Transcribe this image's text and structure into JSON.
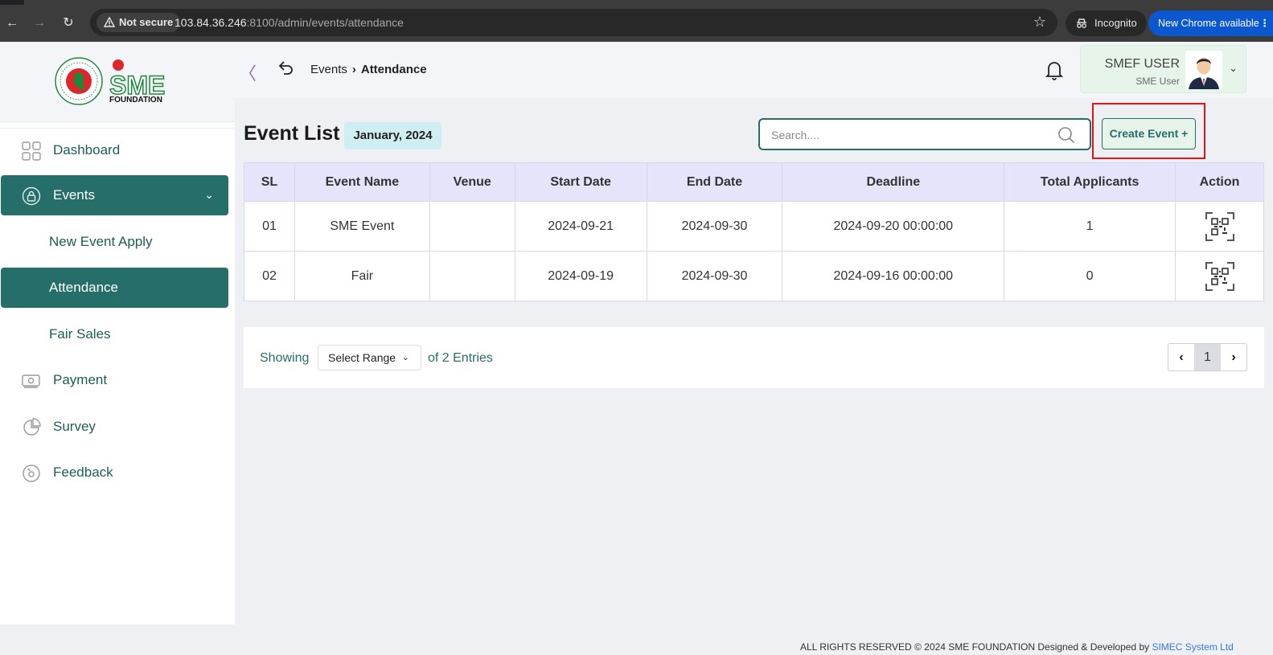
{
  "browser": {
    "security_label": "Not secure",
    "url_host": "103.84.36.246",
    "url_rest": ":8100/admin/events/attendance",
    "incognito_label": "Incognito",
    "update_label": "New Chrome available"
  },
  "logo": {
    "brand_text": "SME",
    "sub_text": "FOUNDATION"
  },
  "sidebar": {
    "items": [
      {
        "label": "Dashboard",
        "icon": "grid-icon"
      },
      {
        "label": "Events",
        "icon": "lock-circle-icon"
      },
      {
        "label": "New Event Apply"
      },
      {
        "label": "Attendance"
      },
      {
        "label": "Fair Sales"
      },
      {
        "label": "Payment",
        "icon": "money-icon"
      },
      {
        "label": "Survey",
        "icon": "pie-chart-icon"
      },
      {
        "label": "Feedback",
        "icon": "feedback-icon"
      }
    ],
    "caret": "⌄"
  },
  "topbar": {
    "collapse": "〈",
    "breadcrumb": {
      "parent": "Events",
      "current": "Attendance"
    },
    "user": {
      "name": "SMEF USER",
      "role": "SME User"
    }
  },
  "page": {
    "title": "Event List",
    "date_badge": "January, 2024",
    "search_placeholder": "Search....",
    "create_button": "Create Event +"
  },
  "table": {
    "headers": [
      "SL",
      "Event Name",
      "Venue",
      "Start Date",
      "End Date",
      "Deadline",
      "Total Applicants",
      "Action"
    ],
    "rows": [
      {
        "sl": "01",
        "name": "SME Event",
        "venue": "",
        "start": "2024-09-21",
        "end": "2024-09-30",
        "deadline": "2024-09-20 00:00:00",
        "applicants": "1"
      },
      {
        "sl": "02",
        "name": "Fair",
        "venue": "",
        "start": "2024-09-19",
        "end": "2024-09-30",
        "deadline": "2024-09-16 00:00:00",
        "applicants": "0"
      }
    ]
  },
  "pagination": {
    "showing": "Showing",
    "range_select": "Select Range",
    "entries": "of 2 Entries",
    "current_page": "1"
  },
  "footer": {
    "text": "ALL RIGHTS RESERVED © 2024 SME FOUNDATION   Designed & Developed by",
    "link": "SIMEC System Ltd"
  },
  "colors": {
    "primary": "#256e69",
    "header_bg": "#e4e5fb",
    "highlight": "#e3131b"
  }
}
